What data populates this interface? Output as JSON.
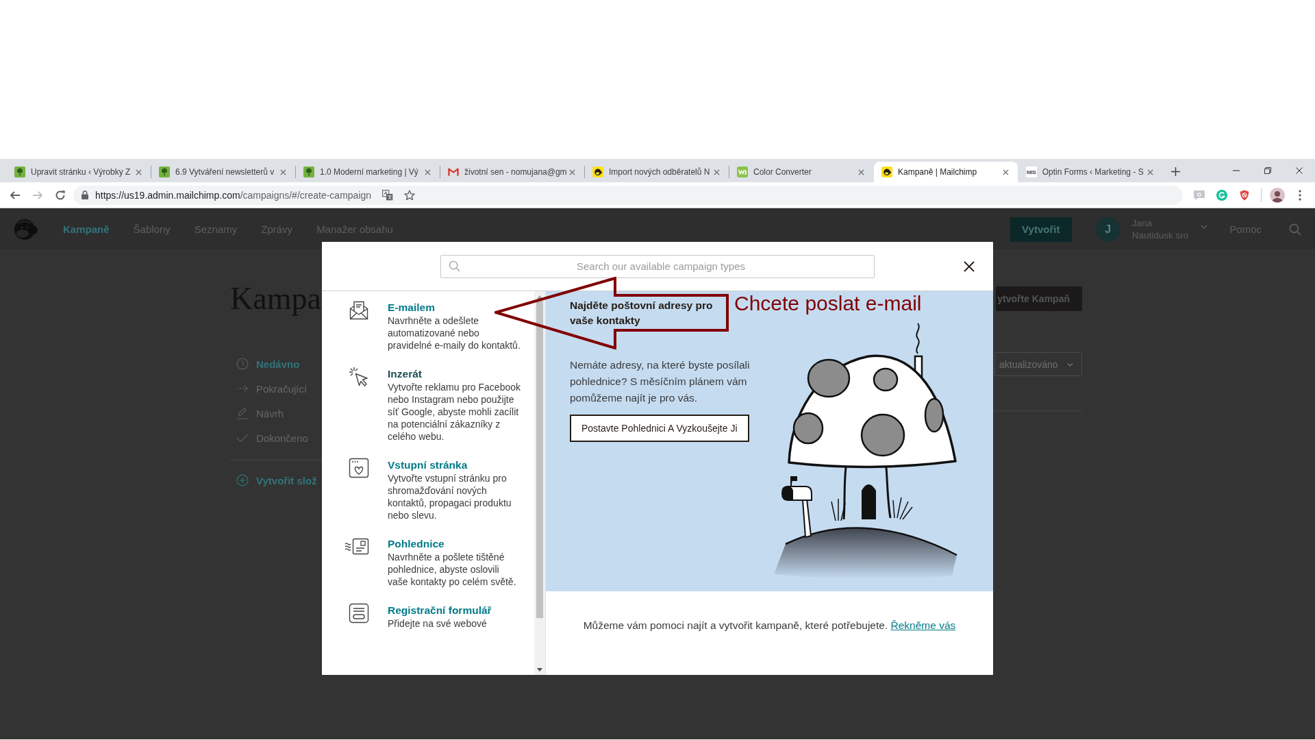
{
  "browser": {
    "tabs": [
      {
        "kind": "leaf",
        "title": "Upravit stránku ‹ Výrobky Z",
        "selected": false
      },
      {
        "kind": "leaf",
        "title": "6.9 Vytváření newsletterů v",
        "selected": false
      },
      {
        "kind": "leaf",
        "title": "1.0 Moderní marketing | Vý",
        "selected": false
      },
      {
        "kind": "mail",
        "title": "životní sen - nomujana@gm",
        "selected": false
      },
      {
        "kind": "chimp",
        "title": "Import nových odběratelů N",
        "selected": false
      },
      {
        "kind": "w3",
        "title": "Color Converter",
        "selected": false
      },
      {
        "kind": "chimp",
        "title": "Kampaně | Mailchimp",
        "selected": true
      },
      {
        "kind": "text",
        "favicon_text": "MIS",
        "title": "Optin Forms ‹ Marketing - S",
        "selected": false
      }
    ],
    "forward_disabled": true,
    "address": {
      "host": "https://us19.admin.mailchimp.com",
      "path": "/campaigns/#/create-campaign"
    }
  },
  "app_header": {
    "nav": [
      {
        "label": "Kampaně",
        "selected": true
      },
      {
        "label": "Šablony",
        "selected": false
      },
      {
        "label": "Seznamy",
        "selected": false
      },
      {
        "label": "Zprávy",
        "selected": false
      },
      {
        "label": "Manažer obsahu",
        "selected": false
      }
    ],
    "create_button": "Vytvořit",
    "user": {
      "initial": "J",
      "name": "Jana",
      "company": "Nautidusk sro"
    },
    "help": "Pomoc"
  },
  "page": {
    "heading": "Kampa",
    "create_campaign_button": "ytvořte Kampaň",
    "filters": [
      {
        "kind": "clock",
        "label": "Nedávno",
        "selected": true
      },
      {
        "kind": "arrow",
        "label": "Pokračující",
        "selected": false
      },
      {
        "kind": "pencil",
        "label": "Návrh",
        "selected": false
      },
      {
        "kind": "check",
        "label": "Dokončeno",
        "selected": false
      }
    ],
    "create_folder": "Vytvořit slož",
    "sort_dropdown": "aktualizováno"
  },
  "modal": {
    "search": {
      "placeholder": "Search our available campaign types"
    },
    "campaign_types": [
      {
        "kind": "email",
        "title": "E-mailem",
        "description": "Navrhněte a odešlete automatizované nebo pravidelné e-maily do kontaktů.",
        "hovered": false
      },
      {
        "kind": "ad",
        "title": "Inzerát",
        "description": "Vytvořte reklamu pro Facebook nebo Instagram nebo použijte síť Google, abyste mohli zacílit na potenciální zákazníky z celého webu.",
        "hovered": true
      },
      {
        "kind": "landing",
        "title": "Vstupní stránka",
        "description": "Vytvořte vstupní stránku pro shromažďování nových kontaktů, propagaci produktu nebo slevu.",
        "hovered": false
      },
      {
        "kind": "postcard",
        "title": "Pohlednice",
        "description": "Navrhněte a pošlete tištěné pohlednice, abyste oslovili vaše kontakty po celém světě.",
        "hovered": false
      },
      {
        "kind": "form",
        "title": "Registrační formulář",
        "description": "Přidejte na své webové",
        "hovered": false
      }
    ],
    "promo": {
      "heading": "Najděte poštovní adresy pro vaše kontakty",
      "text": "Nemáte adresy, na které byste posílali pohlednice? S měsíčním plánem vám pomůžeme najít je pro vás.",
      "button": "Postavte Pohlednici A Vyzkoušejte Ji"
    },
    "footer": {
      "text": "Můžeme vám pomoci najít a vytvořit kampaně, které potřebujete.",
      "link": "Řekněme vás"
    }
  },
  "annotation": {
    "text": "Chcete poslat e-mail"
  }
}
